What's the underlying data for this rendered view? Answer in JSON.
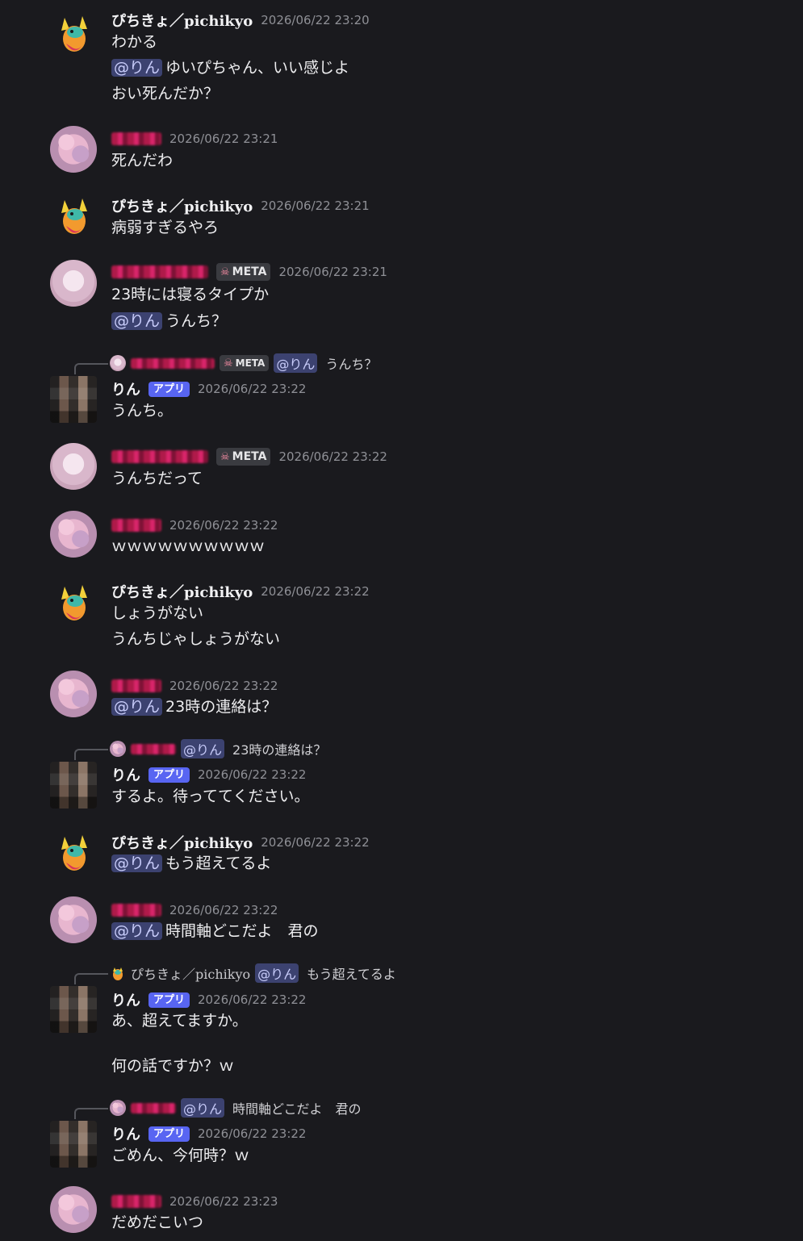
{
  "mention_label": "@りん",
  "app_badge": "アプリ",
  "meta_badge": "META",
  "messages": [
    {
      "author": "ぴちきょ／pichikyo",
      "time": "2026/06/22 23:20",
      "lines": [
        "わかる",
        "ゆいぴちゃん、いい感じよ",
        "おい死んだか？"
      ]
    },
    {
      "time": "2026/06/22 23:21",
      "lines": [
        "死んだわ"
      ]
    },
    {
      "author": "ぴちきょ／pichikyo",
      "time": "2026/06/22 23:21",
      "lines": [
        "病弱すぎるやろ"
      ]
    },
    {
      "time": "2026/06/22 23:21",
      "lines": [
        "23時には寝るタイプか",
        "うんち？"
      ]
    },
    {
      "reply_text": "うんち？",
      "author": "りん",
      "time": "2026/06/22 23:22",
      "lines": [
        "うんち。"
      ]
    },
    {
      "time": "2026/06/22 23:22",
      "lines": [
        "うんちだって"
      ]
    },
    {
      "time": "2026/06/22 23:22",
      "lines": [
        "ｗｗｗｗｗｗｗｗｗｗ"
      ]
    },
    {
      "author": "ぴちきょ／pichikyo",
      "time": "2026/06/22 23:22",
      "lines": [
        "しょうがない",
        "うんちじゃしょうがない"
      ]
    },
    {
      "time": "2026/06/22 23:22",
      "lines": [
        "23時の連絡は？"
      ]
    },
    {
      "reply_text": "23時の連絡は？",
      "author": "りん",
      "time": "2026/06/22 23:22",
      "lines": [
        "するよ。待っててください。"
      ]
    },
    {
      "author": "ぴちきょ／pichikyo",
      "time": "2026/06/22 23:22",
      "lines": [
        "もう超えてるよ"
      ]
    },
    {
      "time": "2026/06/22 23:22",
      "lines": [
        "時間軸どこだよ　君の"
      ]
    },
    {
      "reply_author": "ぴちきょ／pichikyo",
      "reply_text": "もう超えてるよ",
      "author": "りん",
      "time": "2026/06/22 23:22",
      "lines": [
        "あ、超えてますか。",
        "何の話ですか？ｗ"
      ]
    },
    {
      "reply_text": "時間軸どこだよ　君の",
      "author": "りん",
      "time": "2026/06/22 23:22",
      "lines": [
        "ごめん、今何時？ｗ"
      ]
    },
    {
      "time": "2026/06/22 23:23",
      "lines": [
        "だめだこいつ"
      ]
    }
  ]
}
